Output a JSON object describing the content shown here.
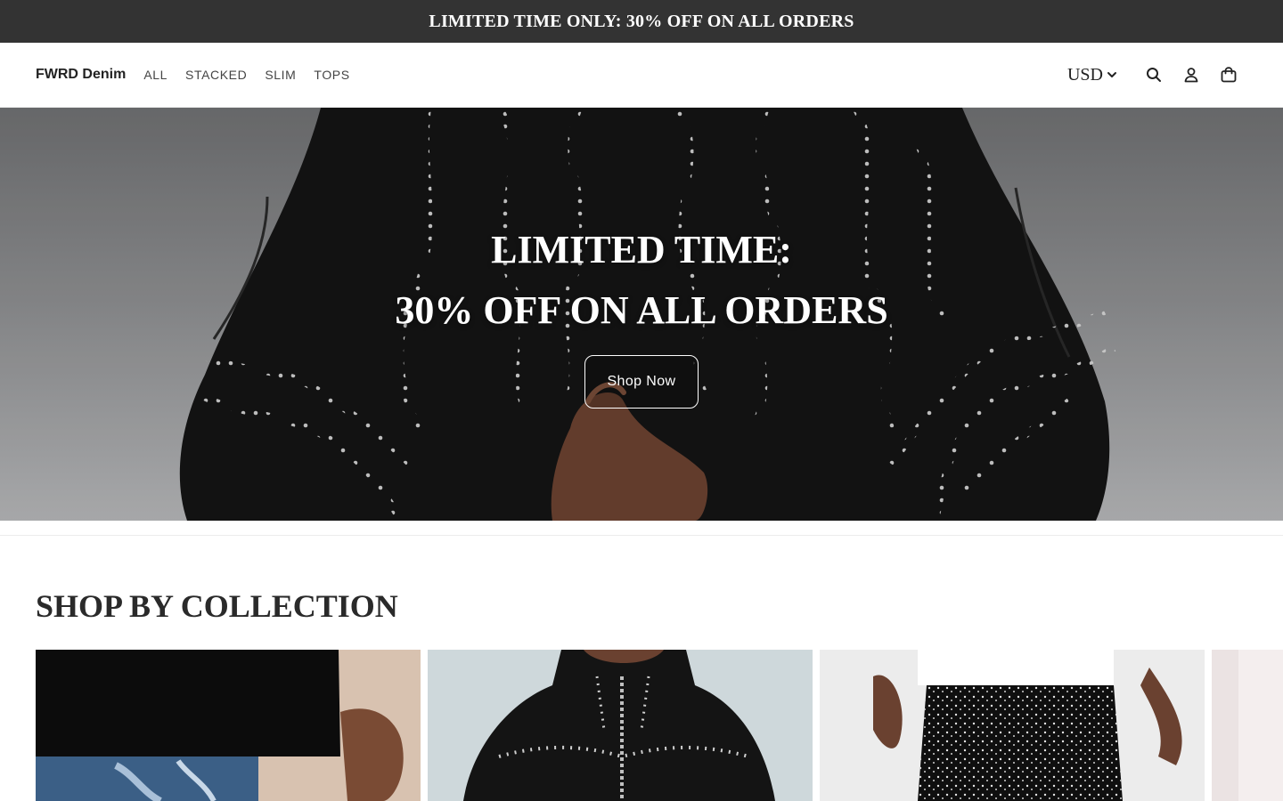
{
  "announcement": {
    "text": "LIMITED TIME ONLY: 30% OFF ON ALL ORDERS"
  },
  "header": {
    "logo": "FWRD Denim",
    "nav": [
      "ALL",
      "STACKED",
      "SLIM",
      "TOPS"
    ],
    "currency": "USD",
    "icons": [
      "search-icon",
      "account-icon",
      "cart-icon"
    ]
  },
  "hero": {
    "title_line1": "LIMITED TIME:",
    "title_line2": "30% OFF ON ALL ORDERS",
    "button_label": "Shop Now"
  },
  "collections": {
    "title": "SHOP BY COLLECTION"
  },
  "colors": {
    "announcement_bg": "#333333",
    "text_dark": "#222222",
    "white": "#ffffff"
  }
}
